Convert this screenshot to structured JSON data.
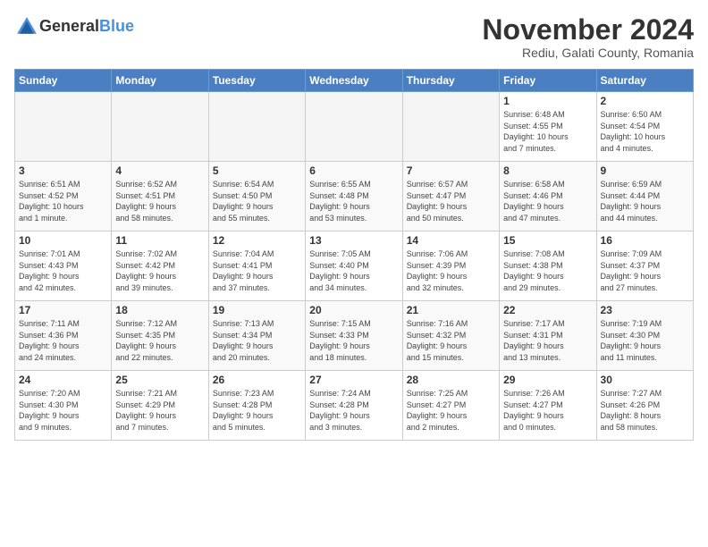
{
  "header": {
    "logo_general": "General",
    "logo_blue": "Blue",
    "title": "November 2024",
    "subtitle": "Rediu, Galati County, Romania"
  },
  "weekdays": [
    "Sunday",
    "Monday",
    "Tuesday",
    "Wednesday",
    "Thursday",
    "Friday",
    "Saturday"
  ],
  "weeks": [
    [
      {
        "day": "",
        "info": ""
      },
      {
        "day": "",
        "info": ""
      },
      {
        "day": "",
        "info": ""
      },
      {
        "day": "",
        "info": ""
      },
      {
        "day": "",
        "info": ""
      },
      {
        "day": "1",
        "info": "Sunrise: 6:48 AM\nSunset: 4:55 PM\nDaylight: 10 hours\nand 7 minutes."
      },
      {
        "day": "2",
        "info": "Sunrise: 6:50 AM\nSunset: 4:54 PM\nDaylight: 10 hours\nand 4 minutes."
      }
    ],
    [
      {
        "day": "3",
        "info": "Sunrise: 6:51 AM\nSunset: 4:52 PM\nDaylight: 10 hours\nand 1 minute."
      },
      {
        "day": "4",
        "info": "Sunrise: 6:52 AM\nSunset: 4:51 PM\nDaylight: 9 hours\nand 58 minutes."
      },
      {
        "day": "5",
        "info": "Sunrise: 6:54 AM\nSunset: 4:50 PM\nDaylight: 9 hours\nand 55 minutes."
      },
      {
        "day": "6",
        "info": "Sunrise: 6:55 AM\nSunset: 4:48 PM\nDaylight: 9 hours\nand 53 minutes."
      },
      {
        "day": "7",
        "info": "Sunrise: 6:57 AM\nSunset: 4:47 PM\nDaylight: 9 hours\nand 50 minutes."
      },
      {
        "day": "8",
        "info": "Sunrise: 6:58 AM\nSunset: 4:46 PM\nDaylight: 9 hours\nand 47 minutes."
      },
      {
        "day": "9",
        "info": "Sunrise: 6:59 AM\nSunset: 4:44 PM\nDaylight: 9 hours\nand 44 minutes."
      }
    ],
    [
      {
        "day": "10",
        "info": "Sunrise: 7:01 AM\nSunset: 4:43 PM\nDaylight: 9 hours\nand 42 minutes."
      },
      {
        "day": "11",
        "info": "Sunrise: 7:02 AM\nSunset: 4:42 PM\nDaylight: 9 hours\nand 39 minutes."
      },
      {
        "day": "12",
        "info": "Sunrise: 7:04 AM\nSunset: 4:41 PM\nDaylight: 9 hours\nand 37 minutes."
      },
      {
        "day": "13",
        "info": "Sunrise: 7:05 AM\nSunset: 4:40 PM\nDaylight: 9 hours\nand 34 minutes."
      },
      {
        "day": "14",
        "info": "Sunrise: 7:06 AM\nSunset: 4:39 PM\nDaylight: 9 hours\nand 32 minutes."
      },
      {
        "day": "15",
        "info": "Sunrise: 7:08 AM\nSunset: 4:38 PM\nDaylight: 9 hours\nand 29 minutes."
      },
      {
        "day": "16",
        "info": "Sunrise: 7:09 AM\nSunset: 4:37 PM\nDaylight: 9 hours\nand 27 minutes."
      }
    ],
    [
      {
        "day": "17",
        "info": "Sunrise: 7:11 AM\nSunset: 4:36 PM\nDaylight: 9 hours\nand 24 minutes."
      },
      {
        "day": "18",
        "info": "Sunrise: 7:12 AM\nSunset: 4:35 PM\nDaylight: 9 hours\nand 22 minutes."
      },
      {
        "day": "19",
        "info": "Sunrise: 7:13 AM\nSunset: 4:34 PM\nDaylight: 9 hours\nand 20 minutes."
      },
      {
        "day": "20",
        "info": "Sunrise: 7:15 AM\nSunset: 4:33 PM\nDaylight: 9 hours\nand 18 minutes."
      },
      {
        "day": "21",
        "info": "Sunrise: 7:16 AM\nSunset: 4:32 PM\nDaylight: 9 hours\nand 15 minutes."
      },
      {
        "day": "22",
        "info": "Sunrise: 7:17 AM\nSunset: 4:31 PM\nDaylight: 9 hours\nand 13 minutes."
      },
      {
        "day": "23",
        "info": "Sunrise: 7:19 AM\nSunset: 4:30 PM\nDaylight: 9 hours\nand 11 minutes."
      }
    ],
    [
      {
        "day": "24",
        "info": "Sunrise: 7:20 AM\nSunset: 4:30 PM\nDaylight: 9 hours\nand 9 minutes."
      },
      {
        "day": "25",
        "info": "Sunrise: 7:21 AM\nSunset: 4:29 PM\nDaylight: 9 hours\nand 7 minutes."
      },
      {
        "day": "26",
        "info": "Sunrise: 7:23 AM\nSunset: 4:28 PM\nDaylight: 9 hours\nand 5 minutes."
      },
      {
        "day": "27",
        "info": "Sunrise: 7:24 AM\nSunset: 4:28 PM\nDaylight: 9 hours\nand 3 minutes."
      },
      {
        "day": "28",
        "info": "Sunrise: 7:25 AM\nSunset: 4:27 PM\nDaylight: 9 hours\nand 2 minutes."
      },
      {
        "day": "29",
        "info": "Sunrise: 7:26 AM\nSunset: 4:27 PM\nDaylight: 9 hours\nand 0 minutes."
      },
      {
        "day": "30",
        "info": "Sunrise: 7:27 AM\nSunset: 4:26 PM\nDaylight: 8 hours\nand 58 minutes."
      }
    ]
  ]
}
